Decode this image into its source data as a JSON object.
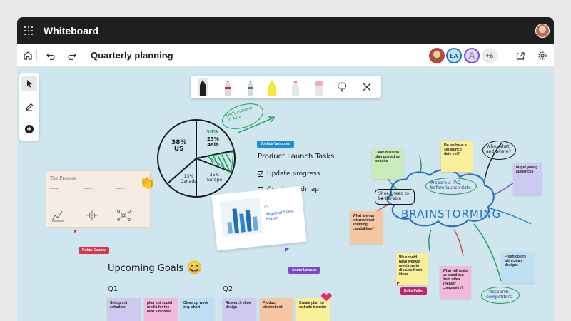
{
  "app": {
    "title": "Whiteboard"
  },
  "toolbar": {
    "doc_title": "Quarterly planning",
    "collaborators": [
      "EA"
    ],
    "more_count": "+6"
  },
  "canvas": {
    "pie": {
      "us": "38%\nUS",
      "asia": "38%",
      "asia2": "25%\nAsia",
      "canada": "13%\nCanada",
      "europe": "25%\nEurope",
      "callout": "Let's expand\nin Asia"
    },
    "tasks": {
      "title": "Product Launch Tasks",
      "items": [
        "Update progress",
        "Create roadmap"
      ]
    },
    "cursors": {
      "joshua": "Joshua Vanburen",
      "robin": "Robin Counts",
      "andre": "Andre Lawson",
      "erika": "Erika Fuller"
    },
    "process": {
      "title": "The Process",
      "cols": [
        "Heading 1",
        "Heading 2",
        "Heading 3"
      ]
    },
    "slide": {
      "num": "02",
      "title": "Regional Sales\nReport"
    },
    "upcoming": {
      "title": "Upcoming Goals",
      "q1": "Q1",
      "q2": "Q2",
      "q1_notes": [
        "Set up crit schedule",
        "plan out social media for the next 3 months",
        "Clean up work org. chart"
      ],
      "q2_notes": [
        "Research shoe design",
        "Product photoshoot",
        "Create plan for website transfer"
      ]
    },
    "brainstorm": {
      "title": "BRAINSTORMING",
      "notes": {
        "clean_mission": "Clean mission plan posted on website",
        "set_launch": "Do we have a set launch date yet?",
        "target_young": "target young audiences",
        "intl_shipping": "What are our international shipping capabilities?",
        "fresh_colors": "Fresh colors with clean designs",
        "weekly_meetings": "We should have weekly meetings to discuss fresh ideas",
        "stand_out": "What will make us stand out from other sneaker companies?"
      },
      "bubbles": {
        "who": "Who, what,\nand where?",
        "faq": "Prepare a FAQ\nbefore launch date",
        "shoes": "Shoes need to\nbe durable",
        "research": "Research\ncompetitors"
      }
    }
  },
  "colors": {
    "titlebar": "#1f1f1f",
    "canvas": "#cfe6ef",
    "lavender": "#cdc9f1",
    "pink": "#f3b9dc",
    "blue": "#bde0f5",
    "yellow": "#fbf09a",
    "green": "#c9ecb9",
    "orange": "#f7c6a3",
    "peach": "#ffd9b8"
  }
}
